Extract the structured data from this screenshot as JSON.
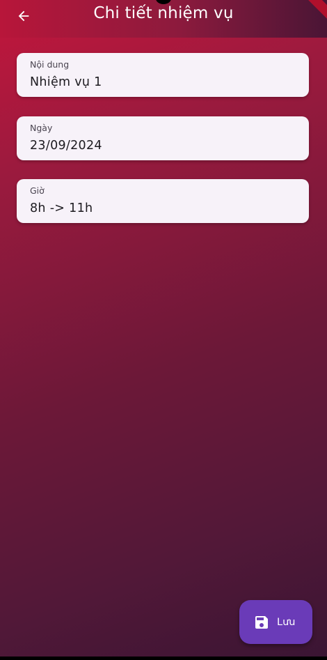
{
  "appbar": {
    "title": "Chi tiết nhiệm vụ",
    "back_icon": "arrow-left-icon"
  },
  "fields": [
    {
      "label": "Nội dung",
      "value": "Nhiệm vụ 1"
    },
    {
      "label": "Ngày",
      "value": "23/09/2024"
    },
    {
      "label": "Giờ",
      "value": "8h -> 11h"
    }
  ],
  "fab": {
    "label": "Lưu",
    "icon": "save-icon"
  },
  "colors": {
    "gradient_start": "#c3163c",
    "gradient_end": "#3a1533",
    "field_background": "#f7f2f9",
    "fab_background": "#6a3bb8",
    "text_on_dark": "#ffffff"
  }
}
